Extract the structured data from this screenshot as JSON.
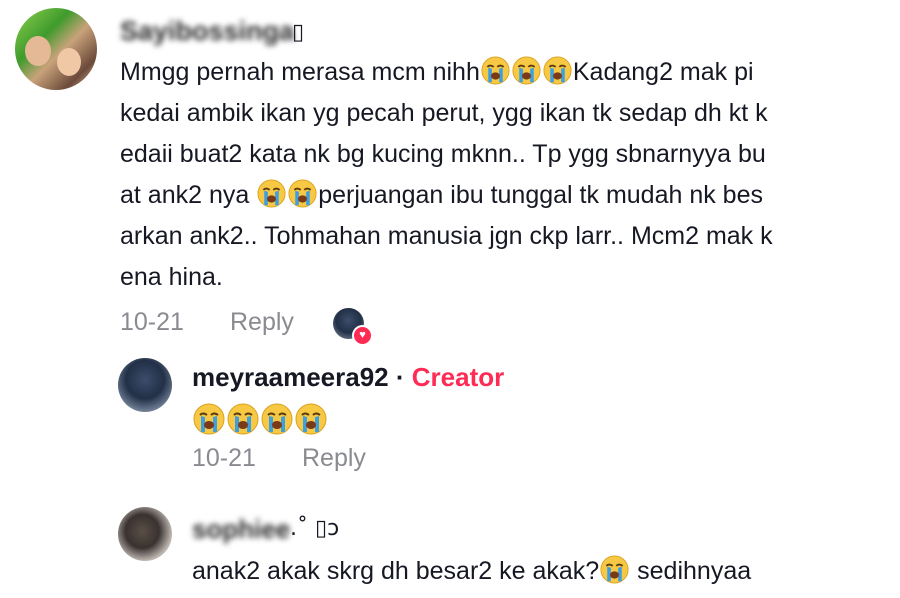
{
  "comments": [
    {
      "username": "Sayibossinga",
      "username_suffix": "▯",
      "lines": [
        [
          "Mmgg pernah merasa mcm nihh",
          "[cry]",
          "[cry]",
          "[cry]",
          "Kadang2 mak pi"
        ],
        [
          "kedai ambik ikan yg pecah perut, ygg ikan tk sedap dh kt k"
        ],
        [
          "edaii buat2 kata nk bg kucing mknn.. Tp ygg sbnarnyya bu"
        ],
        [
          "at ank2 nya ",
          "[cry]",
          "[cry]",
          "perjuangan ibu tunggal tk mudah nk bes"
        ],
        [
          "arkan ank2.. Tohmahan manusia jgn ckp larr.. Mcm2 mak k"
        ],
        [
          "ena hina."
        ]
      ],
      "date": "10-21",
      "reply_label": "Reply",
      "liked_by_creator": true
    },
    {
      "username": "meyraameera92",
      "separator": "·",
      "badge": "Creator",
      "emoji_count": 4,
      "date": "10-21",
      "reply_label": "Reply"
    },
    {
      "username": "sophiee",
      "username_suffix": ".˚ ▯ɔ",
      "text_before": "anak2 akak skrg dh besar2 ke akak?",
      "text_after": " sedihnyaa"
    }
  ],
  "icons": {
    "emoji": "loudly-crying-face-icon",
    "like_badge": "heart-icon"
  },
  "colors": {
    "text": "#161823",
    "muted": "#8a8b91",
    "creator_accent": "#fe2c55",
    "emoji_face": "#f7c844",
    "emoji_tear": "#3e9fe0"
  }
}
